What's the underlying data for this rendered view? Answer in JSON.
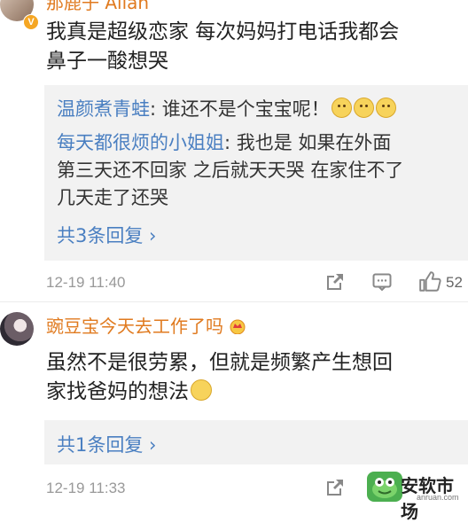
{
  "comment1": {
    "username": "那鹿子 Allan",
    "text_line1": "我真是超级恋家 每次妈妈打电话我都会",
    "text_line2": "鼻子一酸想哭",
    "replies": [
      {
        "user": "温颜煮青蛙",
        "text": ": 谁还不是个宝宝呢！"
      },
      {
        "user": "每天都很烦的小姐姐",
        "text": ": 我也是 如果在外面"
      },
      {
        "text": "第三天还不回家 之后就天天哭 在家住不了"
      },
      {
        "text": "几天走了还哭"
      }
    ],
    "more_replies": "共3条回复 ›",
    "timestamp": "12-19 11:40",
    "like_count": "52"
  },
  "comment2": {
    "username": "豌豆宝今天去工作了吗",
    "text_line1": "虽然不是很劳累，但就是频繁产生想回",
    "text_line2": "家找爸妈的想法",
    "more_replies": "共1条回复 ›",
    "timestamp": "12-19 11:33"
  },
  "watermark": {
    "name": "安软市场",
    "url": "anruan.com"
  },
  "colors": {
    "username": "#e07a1f",
    "link": "#4a7fc1",
    "meta": "#999999",
    "reply_bg": "#f2f2f2"
  }
}
